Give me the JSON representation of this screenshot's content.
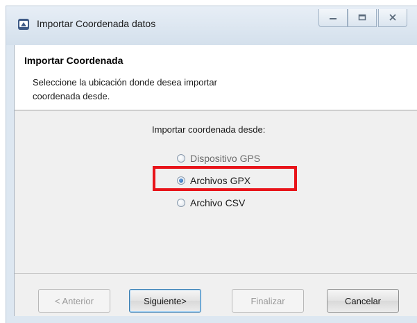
{
  "window": {
    "title": "Importar Coordenada datos",
    "icons": {
      "app": "app-icon",
      "minimize": "minimize-icon",
      "maximize": "maximize-icon",
      "close": "close-icon"
    }
  },
  "header": {
    "title": "Importar Coordenada",
    "description": "Seleccione la ubicación donde desea importar coordenada desde."
  },
  "options": {
    "label": "Importar coordenada desde:",
    "items": [
      {
        "label": "Dispositivo GPS",
        "selected": false
      },
      {
        "label": "Archivos GPX",
        "selected": true
      },
      {
        "label": "Archivo CSV",
        "selected": false
      }
    ]
  },
  "buttons": {
    "previous": "< Anterior",
    "next": "Siguiente>",
    "finish": "Finalizar",
    "cancel": "Cancelar"
  },
  "colors": {
    "highlight": "#e8141a",
    "accent": "#3c7fb1"
  }
}
